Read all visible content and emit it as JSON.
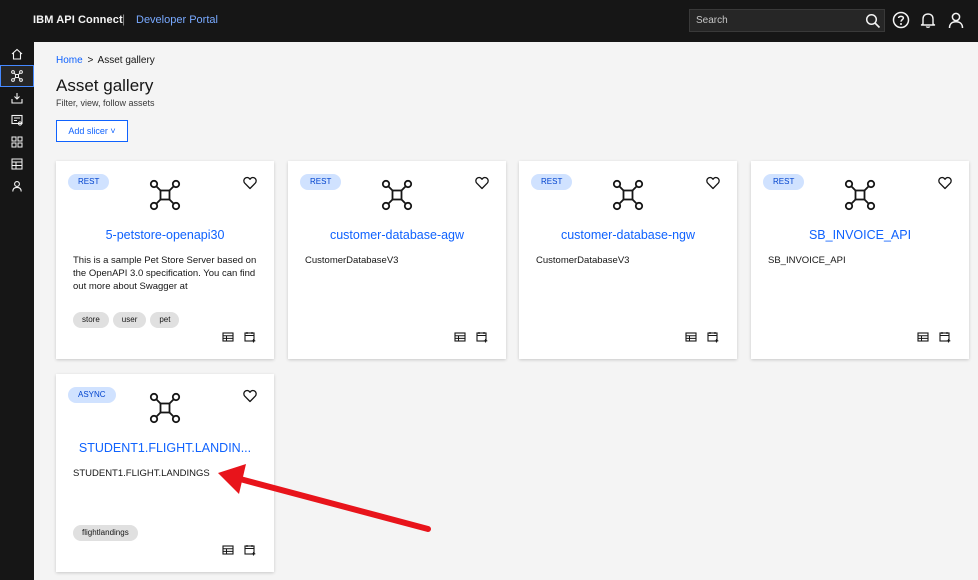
{
  "header": {
    "brand": "IBM API Connect",
    "separator": "|",
    "portal": "Developer Portal",
    "search_placeholder": "Search"
  },
  "nav": {
    "items": [
      {
        "icon": "home-icon"
      },
      {
        "icon": "api-icon",
        "active": true
      },
      {
        "icon": "inbox-icon"
      },
      {
        "icon": "catalog-icon"
      },
      {
        "icon": "apps-icon"
      },
      {
        "icon": "table-icon"
      },
      {
        "icon": "user-icon"
      }
    ]
  },
  "breadcrumb": {
    "home": "Home",
    "separator": ">",
    "current": "Asset gallery"
  },
  "page": {
    "title": "Asset gallery",
    "subtitle": "Filter, view, follow assets",
    "add_slicer": "Add slicer ˅"
  },
  "cards": [
    {
      "type": "REST",
      "title": "5-petstore-openapi30",
      "description": "This is a sample Pet Store Server based on the OpenAPI 3.0 specification. You can find out more about Swagger at",
      "tags": [
        "store",
        "user",
        "pet"
      ]
    },
    {
      "type": "REST",
      "title": "customer-database-agw",
      "description": "CustomerDatabaseV3",
      "tags": []
    },
    {
      "type": "REST",
      "title": "customer-database-ngw",
      "description": "CustomerDatabaseV3",
      "tags": []
    },
    {
      "type": "REST",
      "title": "SB_INVOICE_API",
      "description": "SB_INVOICE_API",
      "tags": []
    },
    {
      "type": "ASYNC",
      "title": "STUDENT1.FLIGHT.LANDIN...",
      "description": "STUDENT1.FLIGHT.LANDINGS",
      "tags": [
        "flightlandings"
      ]
    }
  ],
  "colors": {
    "header_bg": "#161616",
    "accent": "#0f62fe",
    "tag_bg": "#d0e2ff",
    "annotation_arrow": "#e8141b"
  }
}
